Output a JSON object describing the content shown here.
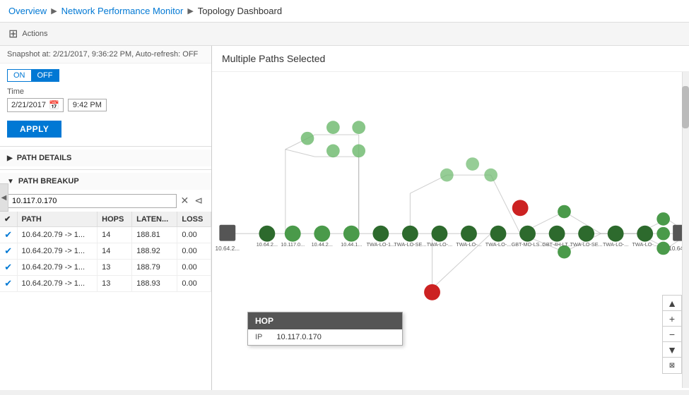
{
  "breadcrumb": {
    "overview": "Overview",
    "monitor": "Network Performance Monitor",
    "dashboard": "Topology Dashboard"
  },
  "actions": {
    "label": "Actions",
    "icon": "⊞"
  },
  "snapshot": {
    "label": "Snapshot at: 2/21/2017, 9:36:22 PM, Auto-refresh: OFF"
  },
  "toggle": {
    "on_label": "ON",
    "off_label": "OFF"
  },
  "time": {
    "label": "Time",
    "date": "2/21/2017",
    "time": "9:42 PM"
  },
  "apply_button": "APPLY",
  "path_details": {
    "label": "PATH DETAILS",
    "collapsed": true
  },
  "path_breakup": {
    "label": "PATH BREAKUP",
    "search_value": "10.117.0.170",
    "columns": [
      "",
      "PATH",
      "HOPS",
      "LATEN...",
      "LOSS"
    ],
    "rows": [
      {
        "checked": true,
        "path": "10.64.20.79 -> 1...",
        "hops": "14",
        "latency": "188.81",
        "loss": "0.00"
      },
      {
        "checked": true,
        "path": "10.64.20.79 -> 1...",
        "hops": "14",
        "latency": "188.92",
        "loss": "0.00"
      },
      {
        "checked": true,
        "path": "10.64.20.79 -> 1...",
        "hops": "13",
        "latency": "188.79",
        "loss": "0.00"
      },
      {
        "checked": true,
        "path": "10.64.20.79 -> 1...",
        "hops": "13",
        "latency": "188.93",
        "loss": "0.00"
      }
    ]
  },
  "topology": {
    "title": "Multiple Paths Selected"
  },
  "hop_tooltip": {
    "header": "HOP",
    "key": "IP",
    "value": "10.117.0.170"
  },
  "zoom": {
    "plus": "+",
    "minus": "−",
    "up": "▲",
    "down": "▼"
  }
}
